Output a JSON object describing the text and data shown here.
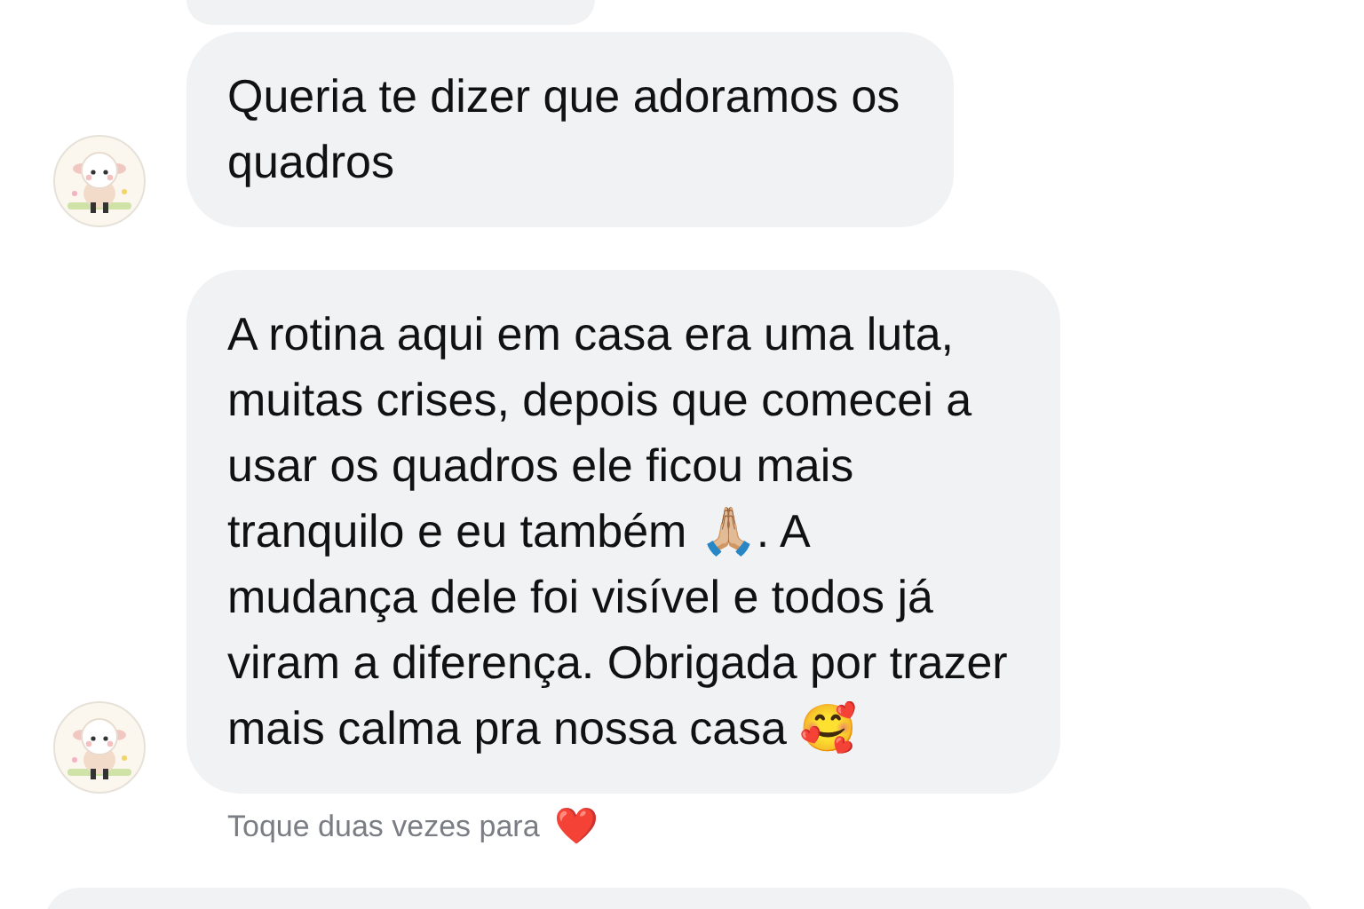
{
  "messages": [
    {
      "text": "Queria te dizer que adoramos os\nquadros"
    },
    {
      "text": "A rotina aqui em casa era uma luta,\nmuitas crises, depois que comecei a\nusar os quadros ele ficou mais\ntranquilo e eu também 🙏🏼. A\nmudança dele foi visível e todos já\nviram a diferença. Obrigada por trazer\nmais calma pra nossa casa 🥰"
    }
  ],
  "hint": {
    "text": "Toque duas vezes para",
    "heart": "❤️"
  }
}
